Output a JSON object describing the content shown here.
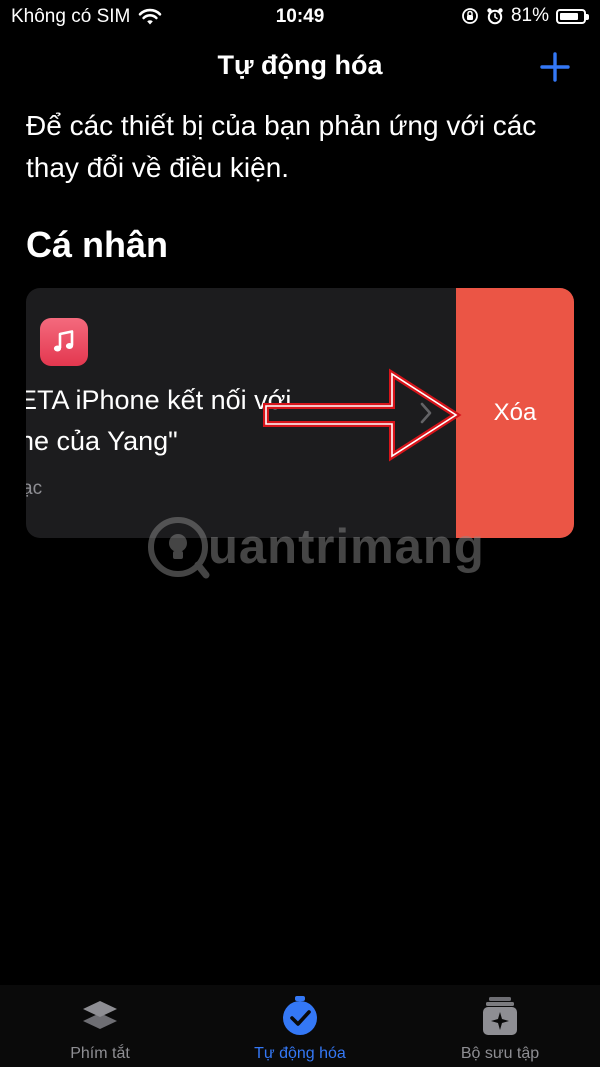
{
  "status_bar": {
    "carrier": "Không có SIM",
    "time": "10:49",
    "battery": "81%",
    "battery_level": 0.81,
    "icons": [
      "wifi-icon",
      "orientation-lock-icon",
      "alarm-icon",
      "battery-icon"
    ]
  },
  "header": {
    "title": "Tự động hóa",
    "add_icon": "plus-icon"
  },
  "description": "Để các thiết bị của bạn phản ứng với các thay đổi về điều kiện.",
  "section": {
    "title": "Cá nhân"
  },
  "automation_card": {
    "icon": "music-icon",
    "title_line_1": "ETA iPhone kết nối với",
    "title_line_2": "ne của Yang\"",
    "subtitle": "ạc",
    "delete_label": "Xóa"
  },
  "watermark": {
    "text": "uantrimang"
  },
  "tab_bar": {
    "tabs": [
      {
        "label": "Phím tắt",
        "icon": "layers-icon",
        "active": false
      },
      {
        "label": "Tự động hóa",
        "icon": "automation-check-icon",
        "active": true
      },
      {
        "label": "Bộ sưu tập",
        "icon": "gallery-icon",
        "active": false
      }
    ]
  },
  "colors": {
    "accent": "#3478f6",
    "delete": "#eb5545",
    "card_background": "#1c1c1e",
    "annotation_arrow": "#d7141a"
  }
}
